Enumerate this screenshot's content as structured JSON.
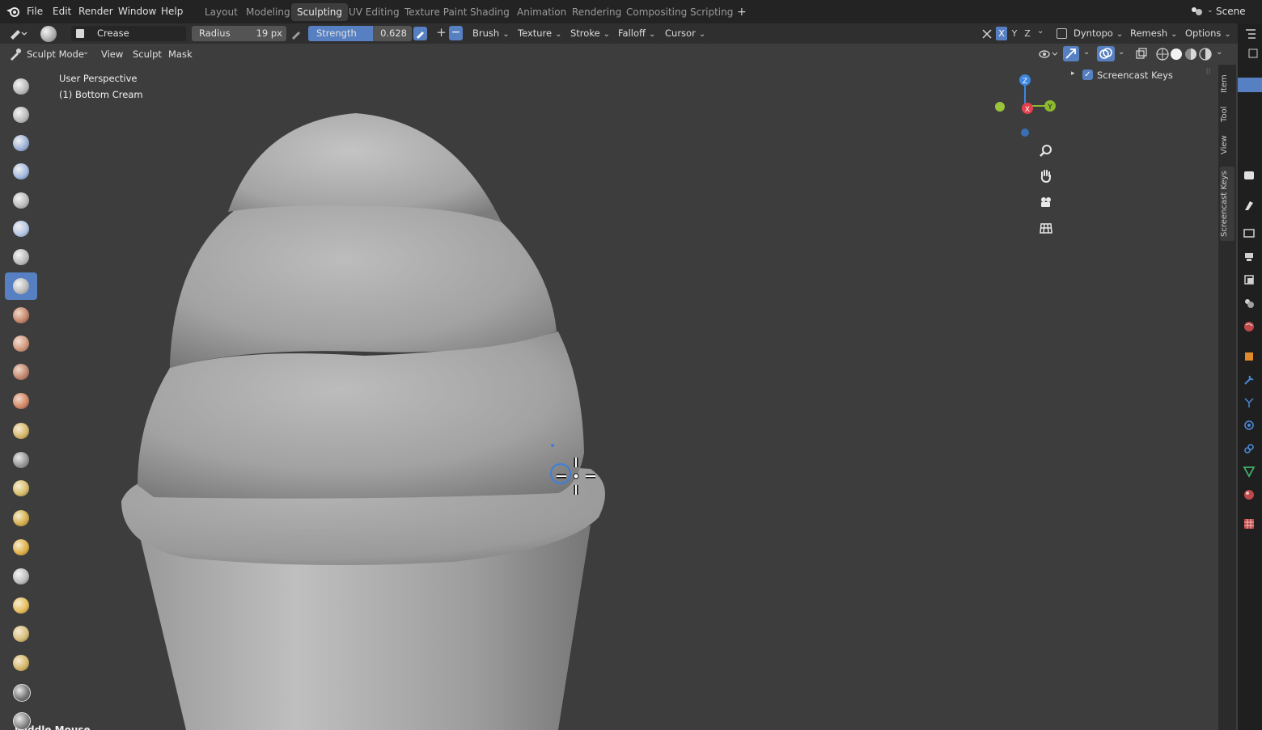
{
  "menubar": {
    "items": [
      "File",
      "Edit",
      "Render",
      "Window",
      "Help"
    ],
    "workspaces": [
      "Layout",
      "Modeling",
      "Sculpting",
      "UV Editing",
      "Texture Paint",
      "Shading",
      "Animation",
      "Rendering",
      "Compositing",
      "Scripting"
    ],
    "active_workspace": "Sculpting",
    "add_tab": "+",
    "scene_label": "Scene"
  },
  "tool_header": {
    "brush_name": "Crease",
    "radius_label": "Radius",
    "radius_value": "19 px",
    "strength_label": "Strength",
    "strength_value": "0.628",
    "plus": "+",
    "minus": "−",
    "dropdowns": [
      "Brush",
      "Texture",
      "Stroke",
      "Falloff",
      "Cursor"
    ],
    "axis": [
      "X",
      "Y",
      "Z"
    ],
    "right_dropdowns": [
      "Dyntopo",
      "Remesh",
      "Options"
    ]
  },
  "mode_header": {
    "mode": "Sculpt Mode",
    "menus": [
      "View",
      "Sculpt",
      "Mask"
    ]
  },
  "viewport": {
    "perspective": "User Perspective",
    "object": "(1) Bottom Cream",
    "bottom_partial": "Middle Mouse"
  },
  "gizmo": {
    "z": "Z",
    "x": "X",
    "y": "Y",
    "colors": {
      "x": "#e4404e",
      "y": "#8cb92f",
      "z": "#3d86e0"
    }
  },
  "sidebar": {
    "panel_title": "Screencast Keys",
    "tabs": [
      "Item",
      "Tool",
      "View",
      "Screencast Keys"
    ]
  },
  "colors": {
    "accent": "#5680c2",
    "viewport_bg": "#3d3d3d",
    "header_bg": "#232323"
  }
}
